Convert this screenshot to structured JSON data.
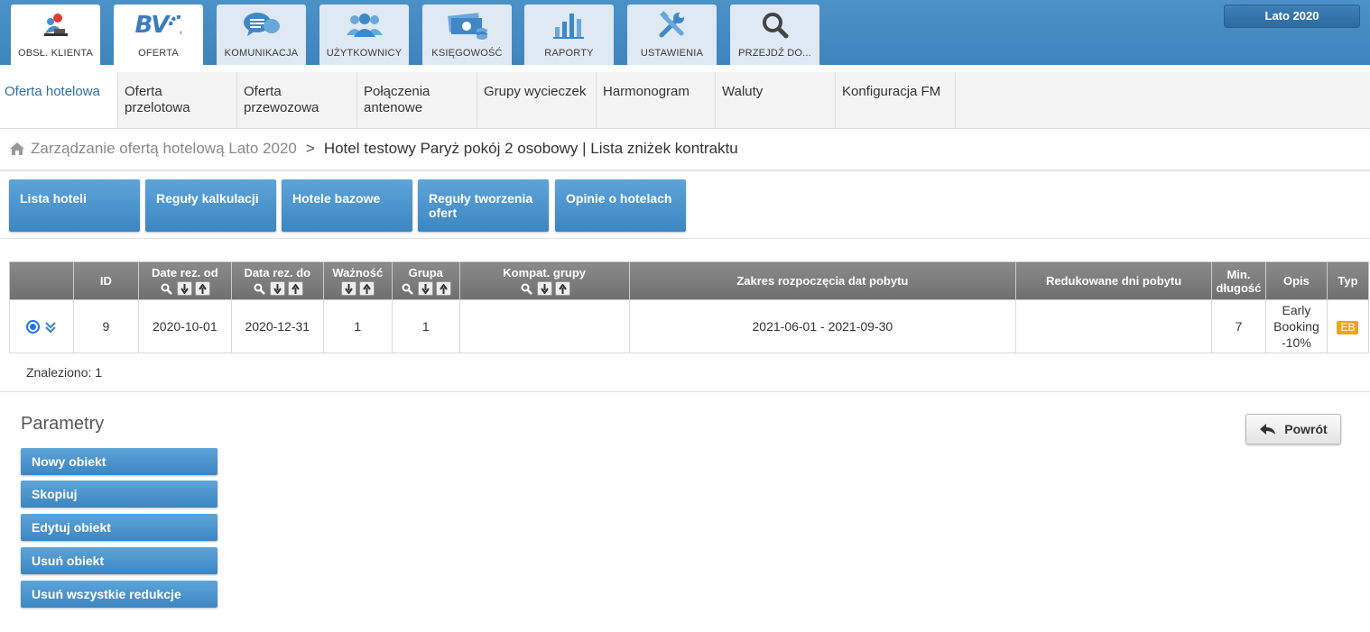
{
  "top_tabs": [
    {
      "label": "OBSŁ. KLIENTA",
      "icon": "customer-service-icon"
    },
    {
      "label": "OFERTA",
      "icon": "bv-logo-icon"
    },
    {
      "label": "KOMUNIKACJA",
      "icon": "chat-bubbles-icon"
    },
    {
      "label": "UŻYTKOWNICY",
      "icon": "users-icon"
    },
    {
      "label": "KSIĘGOWOŚĆ",
      "icon": "money-icon"
    },
    {
      "label": "RAPORTY",
      "icon": "bar-chart-icon"
    },
    {
      "label": "USTAWIENIA",
      "icon": "tools-icon"
    },
    {
      "label": "PRZEJDŹ DO...",
      "icon": "search-icon"
    }
  ],
  "logo_text": "BV",
  "season": "Lato 2020",
  "sub_nav": [
    "Oferta hotelowa",
    "Oferta przelotowa",
    "Oferta przewozowa",
    "Połączenia antenowe",
    "Grupy wycieczek",
    "Harmonogram",
    "Waluty",
    "Konfiguracja FM"
  ],
  "breadcrumb": {
    "parent": "Zarządzanie ofertą hotelową Lato 2020",
    "separator": ">",
    "current": "Hotel testowy Paryż pokój 2 osobowy | Lista zniżek kontraktu"
  },
  "action_buttons": [
    "Lista hoteli",
    "Reguły kalkulacji",
    "Hotele bazowe",
    "Reguły tworzenia ofert",
    "Opinie o hotelach"
  ],
  "table": {
    "headers": {
      "id": "ID",
      "date_from": "Date rez. od",
      "date_to": "Data rez. do",
      "validity": "Ważność",
      "group": "Grupa",
      "compat_groups": "Kompat. grupy",
      "range": "Zakres rozpoczęcia dat pobytu",
      "reduced_days": "Redukowane dni pobytu",
      "min_length": "Min. długość",
      "desc": "Opis",
      "type": "Typ"
    },
    "rows": [
      {
        "id": "9",
        "date_from": "2020-10-01",
        "date_to": "2020-12-31",
        "validity": "1",
        "group": "1",
        "compat_groups": "",
        "range": "2021-06-01 - 2021-09-30",
        "reduced_days": "",
        "min_length": "7",
        "desc": "Early Booking -10%",
        "type": "EB"
      }
    ]
  },
  "found_text": "Znaleziono: 1",
  "params_title": "Parametry",
  "param_buttons": [
    "Nowy obiekt",
    "Skopiuj",
    "Edytuj obiekt",
    "Usuń obiekt",
    "Usuń wszystkie redukcje"
  ],
  "back_button": "Powrót",
  "colors": {
    "topbar": "#4b92c8",
    "button_blue": "#3d86c2",
    "badge_orange": "#f0a418",
    "header_gray": "#7a7a7a"
  }
}
